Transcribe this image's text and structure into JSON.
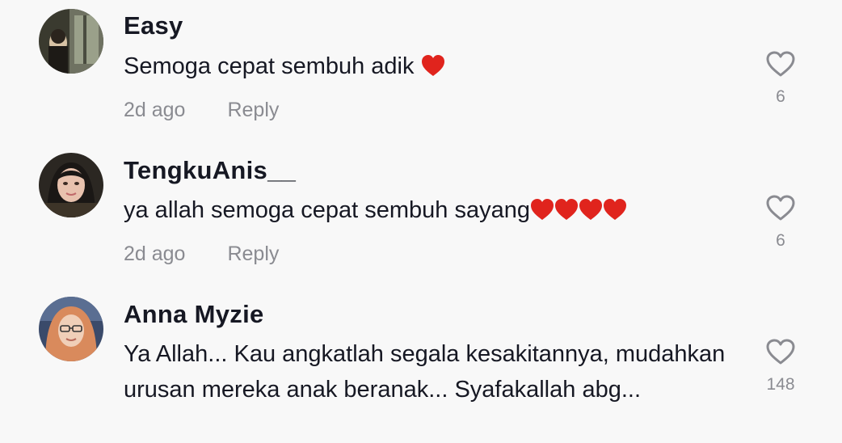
{
  "comments": [
    {
      "username": "Easy",
      "text": "Semoga cepat sembuh adik",
      "hearts": 1,
      "time": "2d ago",
      "reply": "Reply",
      "likes": "6"
    },
    {
      "username": "TengkuAnis__",
      "text": "ya allah semoga cepat sembuh sayang",
      "hearts": 4,
      "time": "2d ago",
      "reply": "Reply",
      "likes": "6"
    },
    {
      "username": "Anna Myzie",
      "text": "Ya Allah... Kau angkatlah segala kesakitannya, mudahkan urusan mereka anak beranak... Syafakallah abg...",
      "hearts": 0,
      "likes": "148"
    }
  ],
  "colors": {
    "background": "#f8f8f8",
    "text": "#161823",
    "secondary": "#8a8b91",
    "heart_emoji": "#e0241d"
  },
  "icons": {
    "like": "heart-outline-icon",
    "emoji": "red-heart-emoji"
  }
}
